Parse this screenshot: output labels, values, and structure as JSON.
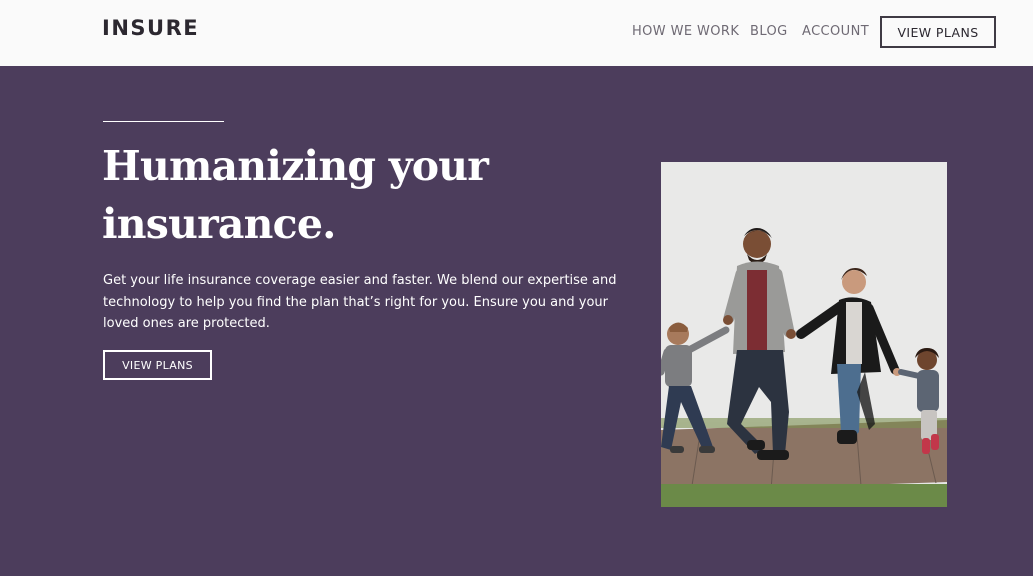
{
  "header": {
    "logo": "INSURE",
    "nav": [
      {
        "label": "HOW WE WORK"
      },
      {
        "label": "BLOG"
      },
      {
        "label": "ACCOUNT"
      }
    ],
    "cta_label": "VIEW PLANS"
  },
  "hero": {
    "title_line1": "Humanizing your",
    "title_line2": "insurance.",
    "text": "Get your life insurance coverage easier and faster. We blend our expertise and technology to help you find the plan that’s right for you. Ensure you and your loved ones are protected.",
    "cta_label": "VIEW PLANS"
  },
  "colors": {
    "header_bg": "#fafafa",
    "hero_bg": "#4c3d5c",
    "text_light": "#ffffff",
    "nav_text": "#6f6a74"
  }
}
